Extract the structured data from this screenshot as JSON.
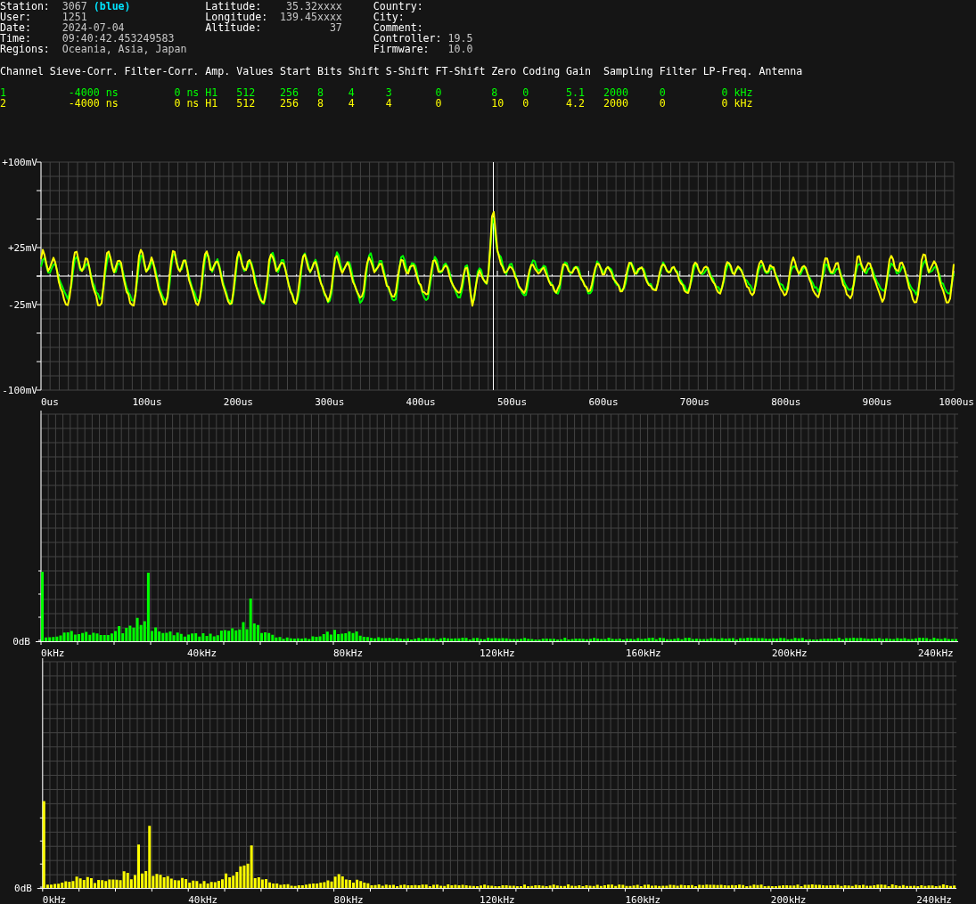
{
  "info_columns": [
    [
      {
        "label": "Station:",
        "value": "3067",
        "note": "(blue)"
      },
      {
        "label": "User:",
        "value": "1251"
      },
      {
        "label": "Date:",
        "value": "2024-07-04"
      },
      {
        "label": "Time:",
        "value": "09:40:42.453249583"
      },
      {
        "label": "Regions:",
        "value": "Oceania, Asia, Japan"
      }
    ],
    [
      {
        "label": "Latitude:",
        "value": "35.32xxxx"
      },
      {
        "label": "Longitude:",
        "value": "139.45xxxx"
      },
      {
        "label": "Altitude:",
        "value": "37"
      }
    ],
    [
      {
        "label": "Country:"
      },
      {
        "label": "City:"
      },
      {
        "label": "Comment:"
      },
      {
        "label": "Controller:",
        "value": "19.5"
      },
      {
        "label": "Firmware:",
        "value": "10.0"
      }
    ]
  ],
  "table": {
    "columns": [
      "Channel",
      "Sieve-Corr.",
      "Filter-Corr.",
      "Amp.",
      "Values",
      "Start",
      "Bits",
      "Shift",
      "S-Shift",
      "FT-Shift",
      "Zero",
      "Coding",
      "Gain",
      "Sampling",
      "Filter",
      "LP-Freq.",
      "Antenna"
    ],
    "rows": [
      {
        "color": "#00ff00",
        "cells": [
          "1",
          "-4000 ns",
          "0 ns",
          "H1",
          "512",
          "256",
          "8",
          "4",
          "3",
          "0",
          "8",
          "0",
          "5.1",
          "2000",
          "0",
          "0 kHz"
        ]
      },
      {
        "color": "#ffff00",
        "cells": [
          "2",
          "-4000 ns",
          "0 ns",
          "H1",
          "512",
          "256",
          "8",
          "4",
          "4",
          "0",
          "10",
          "0",
          "4.2",
          "2000",
          "0",
          "0 kHz"
        ]
      }
    ]
  },
  "waveform": {
    "y_labels": [
      "+100mV",
      "+25mV",
      "-25mV",
      "-100mV"
    ],
    "x_labels": [
      "0us",
      "100us",
      "200us",
      "300us",
      "400us",
      "500us",
      "600us",
      "700us",
      "800us",
      "900us",
      "1000us"
    ],
    "traces": [
      {
        "color": "#00ff00"
      },
      {
        "color": "#ffff00"
      }
    ]
  },
  "spectra": [
    {
      "color": "#00ff00",
      "y_label": "0dB",
      "x_labels": [
        "0kHz",
        "40kHz",
        "80kHz",
        "120kHz",
        "160kHz",
        "200kHz",
        "240kHz"
      ]
    },
    {
      "color": "#ffff00",
      "y_label": "0dB",
      "x_labels": [
        "0kHz",
        "40kHz",
        "80kHz",
        "120kHz",
        "160kHz",
        "200kHz",
        "240kHz"
      ]
    }
  ]
}
